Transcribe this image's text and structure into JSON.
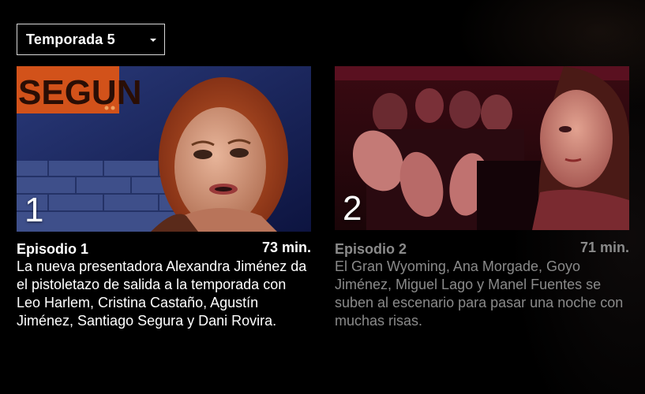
{
  "season_selector": {
    "label": "Temporada 5"
  },
  "episodes": [
    {
      "number": "1",
      "title": "Episodio 1",
      "duration": "73 min.",
      "synopsis": "La nueva presentadora Alexandra Jiménez da el pistoletazo de salida a la temporada con Leo Harlem, Cristina Castaño, Agustín Jiménez, Santiago Segura y Dani Rovira.",
      "thumbnail_sign_text": "SEGUN"
    },
    {
      "number": "2",
      "title": "Episodio 2",
      "duration": "71 min.",
      "synopsis": "El Gran Wyoming, Ana Morgade, Goyo Jiménez, Miguel Lago y Manel Fuentes se suben al escenario para pasar una noche con muchas risas."
    }
  ],
  "colors": {
    "background": "#000000",
    "text_active": "#ffffff",
    "text_inactive": "#8a8a8a"
  }
}
